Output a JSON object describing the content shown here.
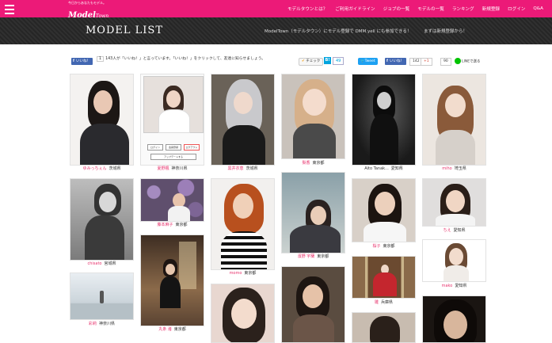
{
  "header": {
    "logo_tagline": "今日からあなたもモデル。",
    "logo_brand": "Model",
    "logo_brand_suffix": "Town",
    "nav": [
      "モデルタウンとは？",
      "ご利用ガイドライン",
      "ジョブの一覧",
      "モデルの一覧",
      "ランキング",
      "新規登録",
      "ログイン",
      "Q&A"
    ]
  },
  "banner": {
    "title": "MODEL LIST",
    "notice": "ModelTown（モデルタウン）にモデル登録で DMM.yell にも参加できる！",
    "notice_cta": "まずは新規登録から！"
  },
  "social": {
    "fb_like_label": "いいね！",
    "fb_like_count": "1",
    "fb_text": "143人が「いいね！」と言っています。「いいね！」をクリックして、友達に知らせましょう。",
    "check_label": "チェック",
    "hatena_count": "49",
    "tweet_label": "Tweet",
    "fb_like2_label": "いいね！",
    "fb_like2_count": "142",
    "gplus_label": "+1",
    "gplus_count": "90",
    "line_label": "LINEで送る"
  },
  "models": [
    {
      "name": "ゆみっちぇん",
      "pref": "茨城県"
    },
    {
      "name": "夏野楓",
      "pref": "神奈川県"
    },
    {
      "name": "黒井衣恵",
      "pref": "茨城県"
    },
    {
      "name": "梨香",
      "pref": "東京都"
    },
    {
      "name": "Aito Tanak...",
      "pref": "愛知県"
    },
    {
      "name": "miho",
      "pref": "埼玉県"
    },
    {
      "name": "chisato",
      "pref": "宮城県"
    },
    {
      "name": "藤本麻子",
      "pref": "東京都"
    },
    {
      "name": "momo",
      "pref": "東京都"
    },
    {
      "name": "濱野 宇蘭",
      "pref": "東京都"
    },
    {
      "name": "桜子",
      "pref": "東京都"
    },
    {
      "name": "ちえ",
      "pref": "愛知県"
    },
    {
      "name": "mako",
      "pref": "愛知県"
    },
    {
      "name": "彩莉",
      "pref": "神奈川県"
    },
    {
      "name": "丸条 渚",
      "pref": "東京都"
    },
    {
      "name": "雛",
      "pref": "兵庫県"
    }
  ],
  "phone_screenshot": {
    "btn1": "ログイン",
    "btn2": "会員登録",
    "btn3": "ログアウト",
    "btn4": "アップデートする"
  }
}
